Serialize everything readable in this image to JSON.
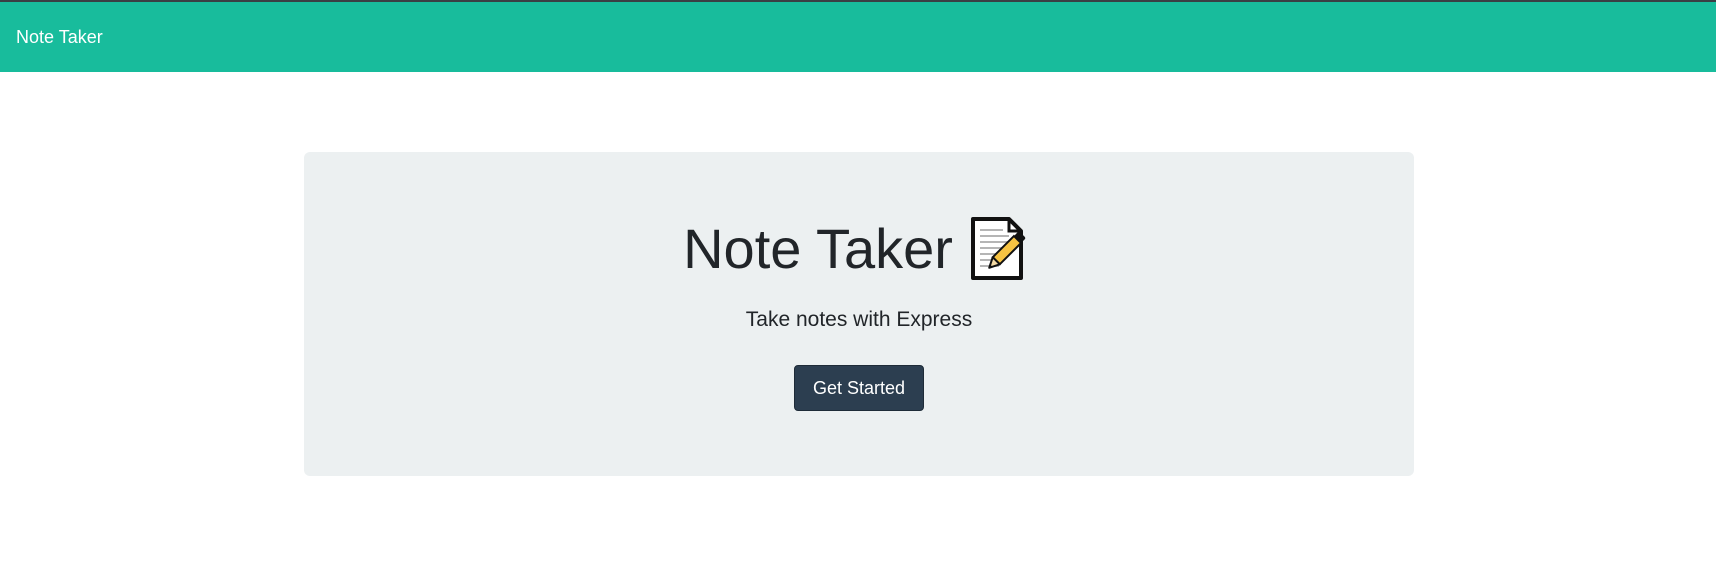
{
  "navbar": {
    "brand": "Note Taker",
    "color": "#18bc9c"
  },
  "hero": {
    "title": "Note Taker",
    "icon": "memo-icon",
    "subtitle": "Take notes with Express",
    "button_label": "Get Started",
    "background": "#ecf0f1",
    "button_color": "#2c3e50"
  }
}
